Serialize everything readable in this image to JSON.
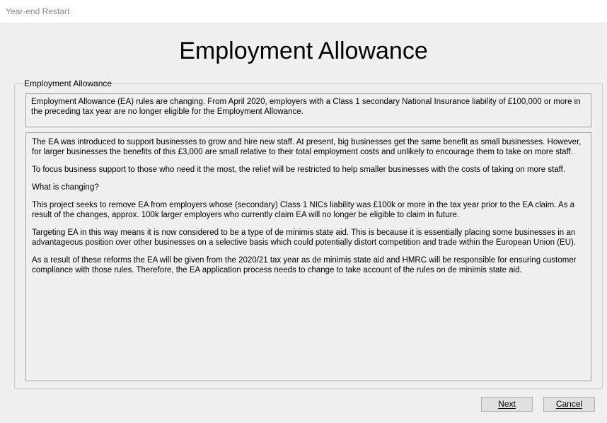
{
  "window": {
    "title": "Year-end Restart"
  },
  "page": {
    "heading": "Employment Allowance"
  },
  "group": {
    "legend": "Employment Allowance",
    "notice": "Employment Allowance (EA) rules are changing. From April 2020, employers with a Class 1 secondary National Insurance liability of £100,000 or more in the preceding tax year are no longer eligible for the Employment Allowance.",
    "paragraphs": [
      "The EA was introduced to support businesses to grow and hire new staff. At present, big businesses get the same benefit as small businesses. However, for larger businesses the benefits of this £3,000 are small relative to their total employment costs and unlikely to encourage them to take on more staff.",
      "To focus business support to those who need it the most, the relief will be restricted to help smaller businesses with the costs of taking on more staff.",
      "What is changing?",
      "This project seeks to remove EA from employers whose (secondary) Class 1 NICs liability was £100k or more in the tax year prior to the EA claim. As a result of the changes, approx. 100k larger employers who currently claim EA will no longer be eligible to claim in future.",
      "Targeting EA in this way means it is now considered to be a type of de minimis state aid. This is because it is essentially placing some businesses in an advantageous position over other businesses on a selective basis which could potentially distort competition and trade within the European Union (EU).",
      "As a result of these reforms the EA will be given from the 2020/21 tax year as de minimis state aid and HMRC will be responsible for ensuring customer compliance with those rules. Therefore, the EA application process needs to change to take account of the rules on de minimis state aid."
    ]
  },
  "buttons": {
    "next_label": "Next",
    "cancel_label": "Cancel"
  }
}
